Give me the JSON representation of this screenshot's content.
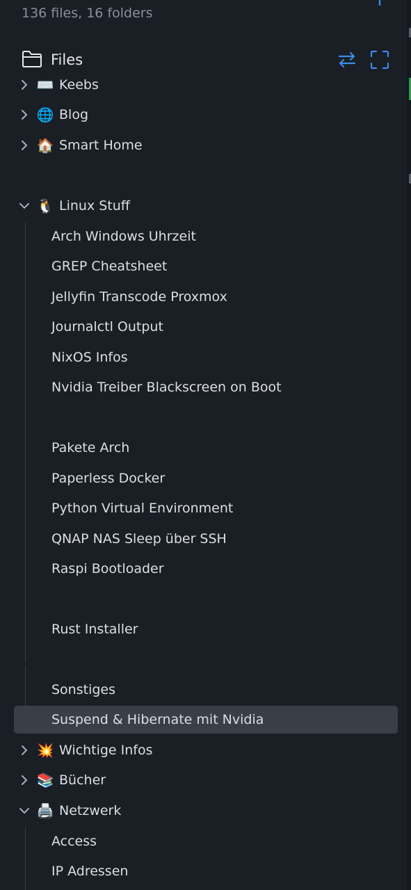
{
  "summary": "136 files, 16 folders",
  "header": {
    "title": "Files",
    "icons": {
      "folder": "folder-icon",
      "sort": "swap-arrows-icon",
      "expand": "fullscreen-icon",
      "new": "plus-icon"
    }
  },
  "tree": [
    {
      "label": "Keebs",
      "emoji": "⌨️",
      "type": "folder",
      "expanded": false
    },
    {
      "label": "Blog",
      "emoji": "🌐",
      "type": "folder",
      "expanded": false
    },
    {
      "label": "Smart Home",
      "emoji": "🏠",
      "type": "folder",
      "expanded": false
    },
    {
      "label": "Linux Stuff",
      "emoji": "🐧",
      "type": "folder",
      "expanded": true,
      "children": [
        "Arch Windows Uhrzeit",
        "GREP Cheatsheet",
        "Jellyfin Transcode Proxmox",
        "Journalctl Output",
        "NixOS Infos",
        "Nvidia Treiber Blackscreen on Boot",
        "Pakete Arch",
        "Paperless Docker",
        "Python Virtual Environment",
        "QNAP NAS Sleep über SSH",
        "Raspi Bootloader",
        "Rust Installer",
        "Sonstiges",
        "Suspend & Hibernate mit Nvidia"
      ]
    },
    {
      "label": "Wichtige Infos",
      "emoji": "💥",
      "type": "folder",
      "expanded": false
    },
    {
      "label": "Bücher",
      "emoji": "📚",
      "type": "folder",
      "expanded": false
    },
    {
      "label": "Netzwerk",
      "emoji": "🖨️",
      "type": "folder",
      "expanded": true,
      "children": [
        "Access",
        "IP Adressen"
      ]
    }
  ],
  "selected": "Suspend & Hibernate mit Nvidia",
  "colors": {
    "accent": "#3d8be8",
    "background": "#1a1e25",
    "selected": "#3a3e46",
    "text": "#dcdfe4",
    "muted": "#8a9099"
  }
}
